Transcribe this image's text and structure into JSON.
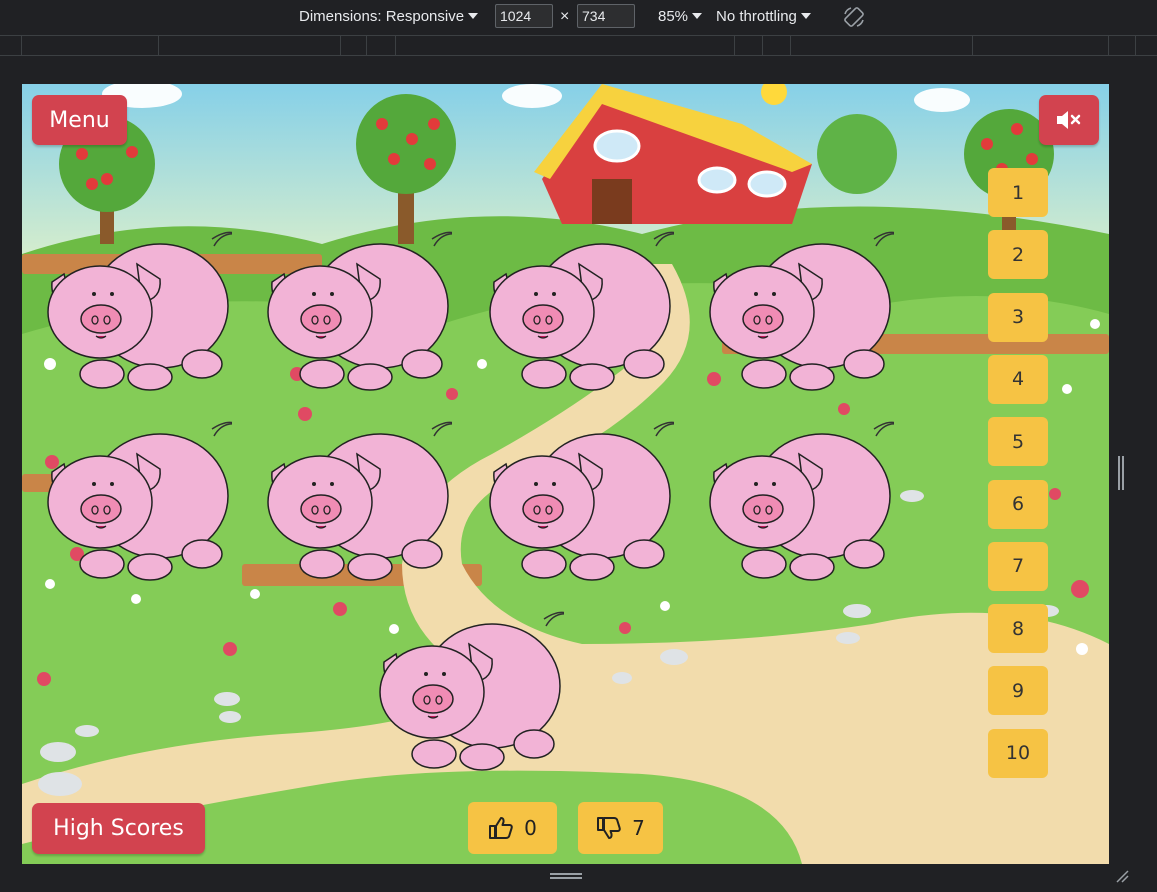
{
  "devtools": {
    "dimensions_label": "Dimensions: Responsive",
    "width_value": "1024",
    "height_value": "734",
    "times_sign": "×",
    "zoom_label": "85%",
    "throttling_label": "No throttling"
  },
  "game": {
    "menu_label": "Menu",
    "mute_icon": "speaker-muted-icon",
    "high_scores_label": "High Scores",
    "number_buttons": [
      "1",
      "2",
      "3",
      "4",
      "5",
      "6",
      "7",
      "8",
      "9",
      "10"
    ],
    "thumbs_up_count": "0",
    "thumbs_down_count": "7",
    "pig_count": 9,
    "colors": {
      "red_button": "#d2434f",
      "yellow_button": "#f6c344",
      "pig_pink": "#f2b3d6",
      "grass": "#8fd36a"
    }
  }
}
